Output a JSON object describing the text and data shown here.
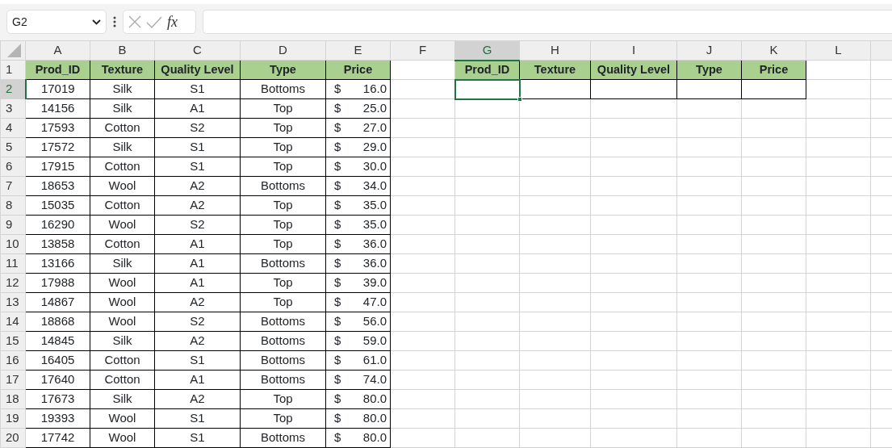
{
  "formula_bar": {
    "name_box": "G2",
    "function_button": "fx"
  },
  "columns": [
    {
      "label": "A",
      "selected": false
    },
    {
      "label": "B",
      "selected": false
    },
    {
      "label": "C",
      "selected": false
    },
    {
      "label": "D",
      "selected": false
    },
    {
      "label": "E",
      "selected": false
    },
    {
      "label": "F",
      "selected": false
    },
    {
      "label": "G",
      "selected": true
    },
    {
      "label": "H",
      "selected": false
    },
    {
      "label": "I",
      "selected": false
    },
    {
      "label": "J",
      "selected": false
    },
    {
      "label": "K",
      "selected": false
    },
    {
      "label": "L",
      "selected": false
    }
  ],
  "row_numbers": [
    {
      "label": "1",
      "selected": false
    },
    {
      "label": "2",
      "selected": true
    },
    {
      "label": "3",
      "selected": false
    },
    {
      "label": "4",
      "selected": false
    },
    {
      "label": "5",
      "selected": false
    },
    {
      "label": "6",
      "selected": false
    },
    {
      "label": "7",
      "selected": false
    },
    {
      "label": "8",
      "selected": false
    },
    {
      "label": "9",
      "selected": false
    },
    {
      "label": "10",
      "selected": false
    },
    {
      "label": "11",
      "selected": false
    },
    {
      "label": "12",
      "selected": false
    },
    {
      "label": "13",
      "selected": false
    },
    {
      "label": "14",
      "selected": false
    },
    {
      "label": "15",
      "selected": false
    },
    {
      "label": "16",
      "selected": false
    },
    {
      "label": "17",
      "selected": false
    },
    {
      "label": "18",
      "selected": false
    },
    {
      "label": "19",
      "selected": false
    },
    {
      "label": "20",
      "selected": false
    }
  ],
  "source_table": {
    "headers": [
      "Prod_ID",
      "Texture",
      "Quality Level",
      "Type",
      "Price"
    ],
    "rows": [
      {
        "cells": [
          "17019",
          "Silk",
          "S1",
          "Bottoms"
        ],
        "currency": "$",
        "price": "16.0"
      },
      {
        "cells": [
          "14156",
          "Silk",
          "A1",
          "Top"
        ],
        "currency": "$",
        "price": "25.0"
      },
      {
        "cells": [
          "17593",
          "Cotton",
          "S2",
          "Top"
        ],
        "currency": "$",
        "price": "27.0"
      },
      {
        "cells": [
          "17572",
          "Silk",
          "S1",
          "Top"
        ],
        "currency": "$",
        "price": "29.0"
      },
      {
        "cells": [
          "17915",
          "Cotton",
          "S1",
          "Top"
        ],
        "currency": "$",
        "price": "30.0"
      },
      {
        "cells": [
          "18653",
          "Wool",
          "A2",
          "Bottoms"
        ],
        "currency": "$",
        "price": "34.0"
      },
      {
        "cells": [
          "15035",
          "Cotton",
          "A2",
          "Top"
        ],
        "currency": "$",
        "price": "35.0"
      },
      {
        "cells": [
          "16290",
          "Wool",
          "S2",
          "Top"
        ],
        "currency": "$",
        "price": "35.0"
      },
      {
        "cells": [
          "13858",
          "Cotton",
          "A1",
          "Top"
        ],
        "currency": "$",
        "price": "36.0"
      },
      {
        "cells": [
          "13166",
          "Silk",
          "A1",
          "Bottoms"
        ],
        "currency": "$",
        "price": "36.0"
      },
      {
        "cells": [
          "17988",
          "Wool",
          "A1",
          "Top"
        ],
        "currency": "$",
        "price": "39.0"
      },
      {
        "cells": [
          "14867",
          "Wool",
          "A2",
          "Top"
        ],
        "currency": "$",
        "price": "47.0"
      },
      {
        "cells": [
          "18868",
          "Wool",
          "S2",
          "Bottoms"
        ],
        "currency": "$",
        "price": "56.0"
      },
      {
        "cells": [
          "14845",
          "Silk",
          "A2",
          "Bottoms"
        ],
        "currency": "$",
        "price": "59.0"
      },
      {
        "cells": [
          "16405",
          "Cotton",
          "S1",
          "Bottoms"
        ],
        "currency": "$",
        "price": "61.0"
      },
      {
        "cells": [
          "17640",
          "Cotton",
          "A1",
          "Bottoms"
        ],
        "currency": "$",
        "price": "74.0"
      },
      {
        "cells": [
          "17673",
          "Silk",
          "A2",
          "Top"
        ],
        "currency": "$",
        "price": "80.0"
      },
      {
        "cells": [
          "19393",
          "Wool",
          "S1",
          "Top"
        ],
        "currency": "$",
        "price": "80.0"
      },
      {
        "cells": [
          "17742",
          "Wool",
          "S1",
          "Bottoms"
        ],
        "currency": "$",
        "price": "80.0"
      }
    ]
  },
  "lookup_table": {
    "headers": [
      "Prod_ID",
      "Texture",
      "Quality Level",
      "Type",
      "Price"
    ],
    "entry_cells": [
      {
        "selected": true
      },
      {
        "selected": false
      },
      {
        "selected": false
      },
      {
        "selected": false
      },
      {
        "selected": false
      }
    ]
  }
}
